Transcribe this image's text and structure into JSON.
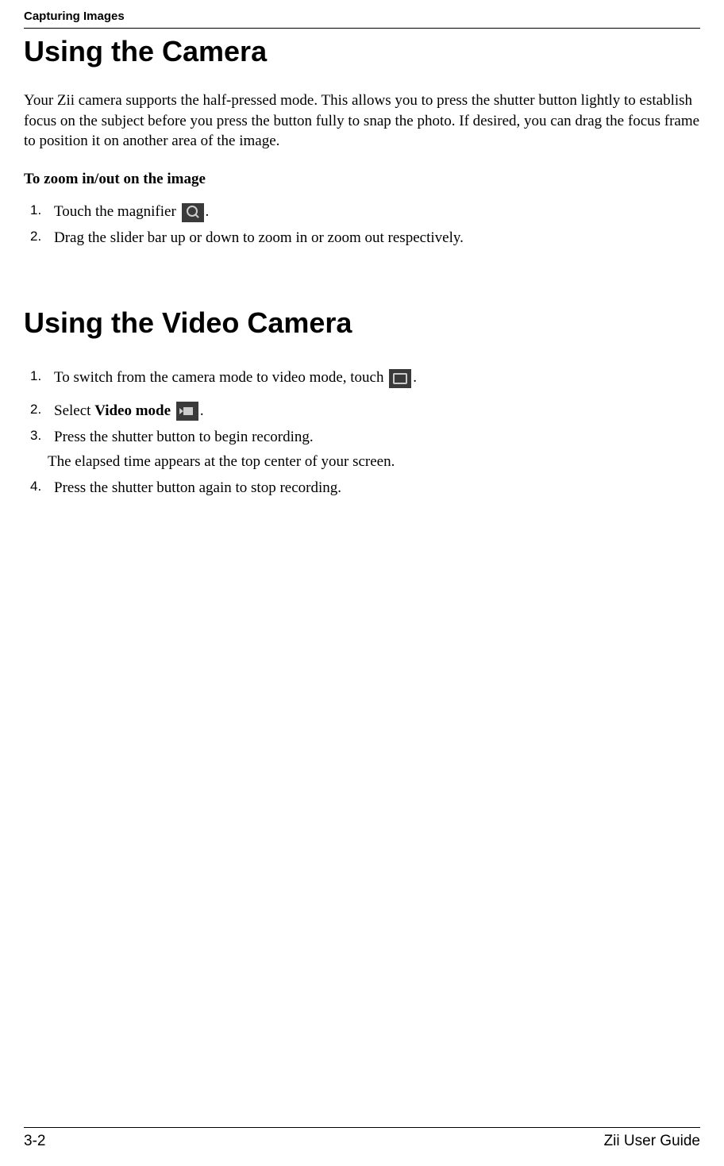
{
  "header": {
    "chapter_label": "Capturing Images"
  },
  "section1": {
    "title": "Using the Camera",
    "intro": "Your Zii camera supports the half-pressed mode. This allows you to press the shutter button lightly to estab­lish focus on the subject before you press the button fully to snap the photo. If desired, you can drag the focus frame to position it on another area of the image.",
    "subheading": "To zoom in/out on the image",
    "step1_num": "1.",
    "step1_before": "Touch the magnifier ",
    "step1_after": ".",
    "step2_num": "2.",
    "step2": "Drag the slider bar up or down to zoom in or zoom out respectively."
  },
  "section2": {
    "title": "Using the Video Camera",
    "step1_num": "1.",
    "step1_before": "To switch from the camera mode to video mode, touch ",
    "step1_after": ".",
    "step2_num": "2.",
    "step2_before": "Select ",
    "step2_bold": "Video mode",
    "step2_after": ".",
    "step3_num": "3.",
    "step3": "Press the shutter button to begin recording.",
    "step3_sub": "The elapsed time appears at the top center of your screen.",
    "step4_num": "4.",
    "step4": "Press the shutter button again to stop recording."
  },
  "footer": {
    "page": "3-2",
    "guide": "Zii User Guide"
  }
}
